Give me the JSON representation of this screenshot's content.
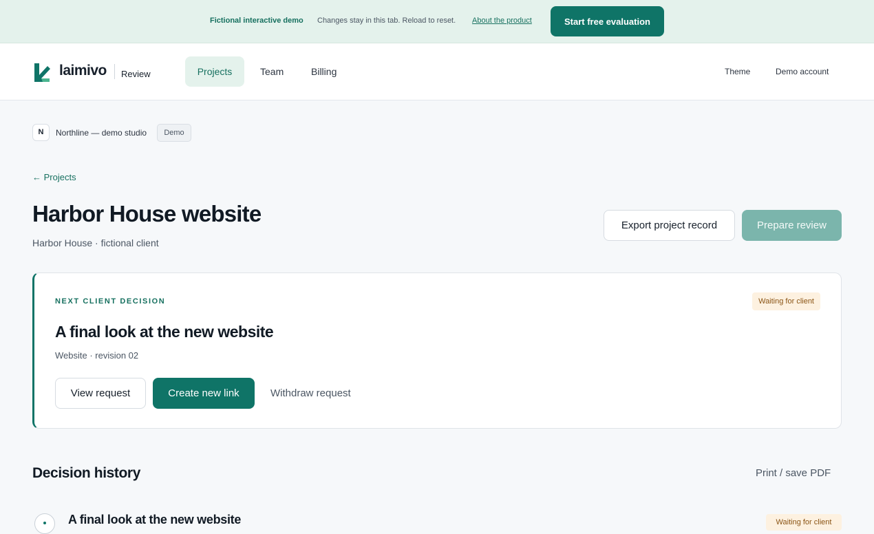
{
  "banner": {
    "tag": "Fictional interactive demo",
    "note": "Changes stay in this tab. Reload to reset.",
    "link": "About the product",
    "cta": "Start free evaluation"
  },
  "nav": {
    "brand": "laimivo",
    "product": "Review",
    "tabs": [
      {
        "label": "Projects",
        "active": true
      },
      {
        "label": "Team",
        "active": false
      },
      {
        "label": "Billing",
        "active": false
      }
    ],
    "theme": "Theme",
    "account": "Demo account"
  },
  "org": {
    "initial": "N",
    "name": "Northline — demo studio",
    "badge": "Demo"
  },
  "page": {
    "back_link": "← Projects",
    "title": "Harbor House website",
    "subtitle": "Harbor House · fictional client",
    "export_label": "Export project record",
    "prepare_label": "Prepare review"
  },
  "decision": {
    "eyebrow": "NEXT CLIENT DECISION",
    "status": "Waiting for client",
    "title": "A final look at the new website",
    "meta": "Website · revision 02",
    "view_label": "View request",
    "create_label": "Create new link",
    "withdraw_label": "Withdraw request"
  },
  "history": {
    "title": "Decision history",
    "print_label": "Print / save PDF",
    "items": [
      {
        "title": "A final look at the new website",
        "status": "Waiting for client"
      }
    ]
  },
  "colors": {
    "accent": "#0f7467",
    "accent_soft": "#e4f2ec",
    "warning_bg": "#fdf1e0",
    "warning_text": "#8a5414"
  }
}
